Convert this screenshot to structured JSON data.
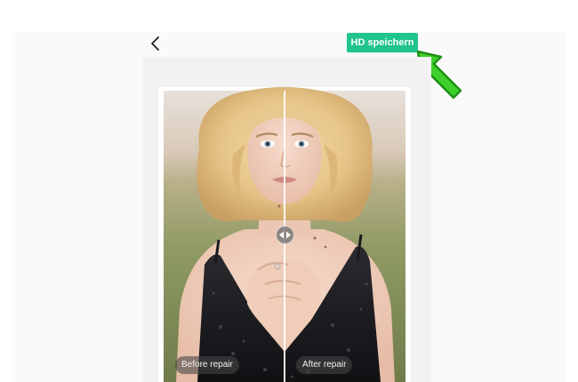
{
  "header": {
    "back_icon": "chevron-left-icon",
    "save_button_label": "HD speichern"
  },
  "editor": {
    "before_label": "Before repair",
    "after_label": "After repair",
    "divider_handle_icon": "left-right-arrows-icon"
  },
  "annotation": {
    "cursor_icon": "arrow-pointer-icon",
    "cursor_color": "#3ecf2a"
  },
  "colors": {
    "accent": "#1fc48e",
    "panel_bg": "#f2f2f3"
  }
}
